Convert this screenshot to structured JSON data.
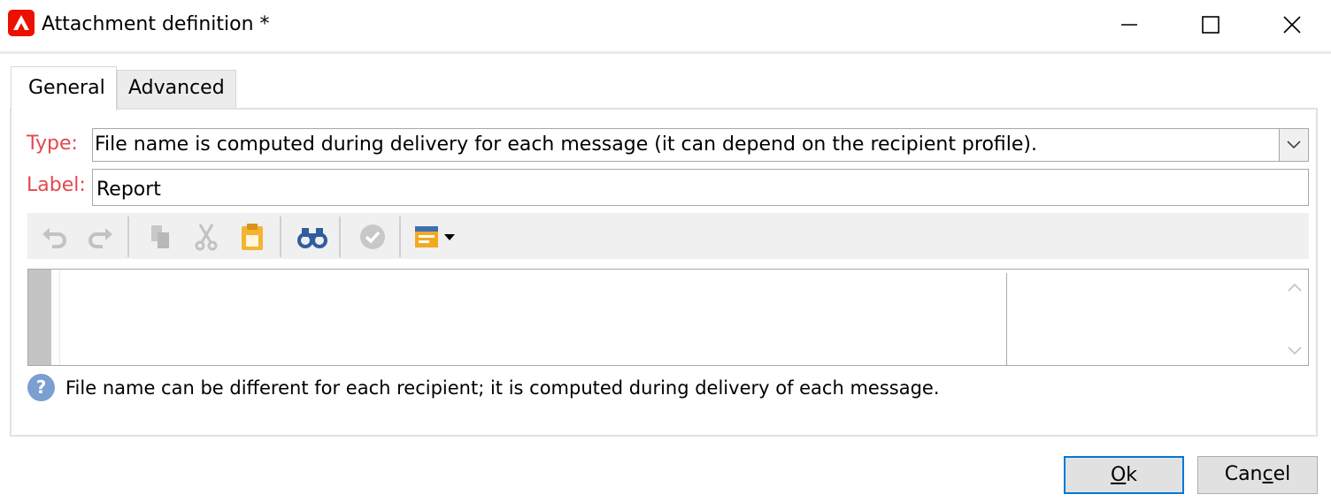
{
  "window": {
    "title": "Attachment definition *",
    "app_icon": "adobe-campaign-icon",
    "controls": [
      "minimize-icon",
      "maximize-icon",
      "close-icon"
    ]
  },
  "tabs": [
    {
      "label": "General",
      "active": true
    },
    {
      "label": "Advanced",
      "active": false
    }
  ],
  "form": {
    "type_label": "Type:",
    "type_value": "File name is computed during delivery for each message (it can depend on the recipient profile).",
    "label_label": "Label:",
    "label_value": "Report"
  },
  "toolbar": {
    "icons": [
      "undo-icon",
      "redo-icon",
      "copy-icon",
      "cut-icon",
      "paste-icon",
      "find-icon",
      "check-icon",
      "insert-field-icon"
    ]
  },
  "help": {
    "text": "File name can be different for each recipient; it is computed during delivery of each message."
  },
  "buttons": {
    "ok_accel": "O",
    "ok_rest": "k",
    "cancel_prefix": "Can",
    "cancel_accel": "c",
    "cancel_rest": "el"
  },
  "colors": {
    "required_label": "#e34850",
    "app_icon_bg": "#eb1000",
    "default_button_border": "#0078d7",
    "help_icon_bg": "#7a9fd0"
  }
}
